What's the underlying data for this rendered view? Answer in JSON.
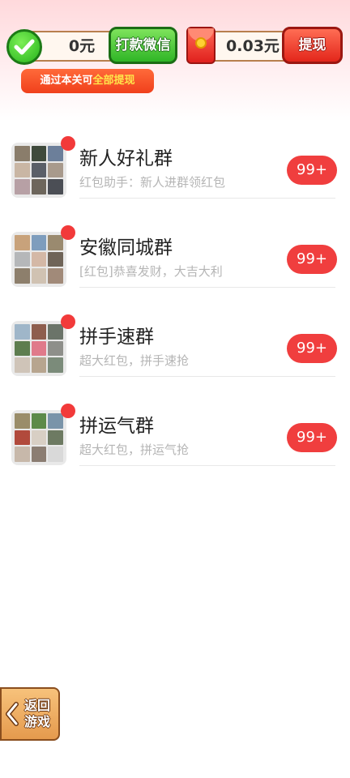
{
  "header": {
    "balance_left": "0元",
    "withdraw_wechat_label": "打款微信",
    "balance_right": "0.03元",
    "withdraw_label": "提现",
    "hint_prefix": "通过本关可",
    "hint_highlight": "全部提现"
  },
  "groups": [
    {
      "title": "新人好礼群",
      "subtitle": "红包助手：新人进群领红包",
      "badge": "99+",
      "avatar_colors": [
        "#8a7d6b",
        "#3f4a3c",
        "#6c7f9a",
        "#c9b6a4",
        "#5a5f68",
        "#a89a8c",
        "#b7a0a5",
        "#6d665c",
        "#4b4e55"
      ]
    },
    {
      "title": "安徽同城群",
      "subtitle": "[红包]恭喜发财，大吉大利",
      "badge": "99+",
      "avatar_colors": [
        "#c8a27b",
        "#7e9dbd",
        "#9a8a6f",
        "#b5b7b9",
        "#d4b8a6",
        "#6f6458",
        "#8d7f6c",
        "#d0c2b2",
        "#a18a79"
      ]
    },
    {
      "title": "拼手速群",
      "subtitle": "超大红包，拼手速抢",
      "badge": "99+",
      "avatar_colors": [
        "#9fb6c9",
        "#8e5e4e",
        "#6b7469",
        "#5d7d4f",
        "#e07a8a",
        "#8e8f8a",
        "#cfc4b8",
        "#b7a58f",
        "#7b8b7a"
      ]
    },
    {
      "title": "拼运气群",
      "subtitle": "超大红包，拼运气抢",
      "badge": "99+",
      "avatar_colors": [
        "#9a8d6a",
        "#5d8a49",
        "#7a94a9",
        "#b14a3c",
        "#d8cfc4",
        "#6d7a62",
        "#c7b8aa",
        "#8b7d72",
        "#d9d9d9"
      ]
    }
  ],
  "back_button": {
    "label_line1": "返回",
    "label_line2": "游戏"
  }
}
